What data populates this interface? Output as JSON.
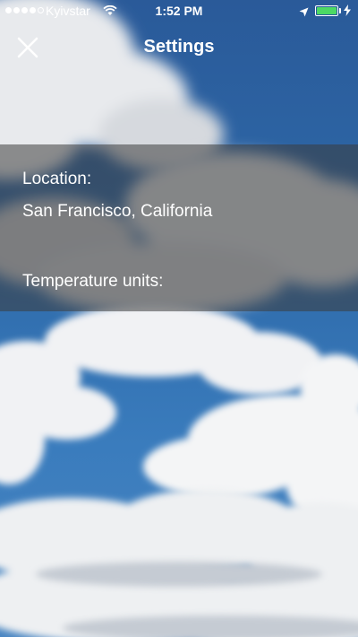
{
  "status_bar": {
    "signal_bars_filled": 4,
    "signal_bars_total": 5,
    "carrier": "Kyivstar",
    "time": "1:52 PM",
    "battery_level": 1.0,
    "battery_color": "#4cd964",
    "icons": [
      "wifi-icon",
      "location-arrow-icon",
      "battery-icon",
      "charging-bolt-icon"
    ]
  },
  "header": {
    "title": "Settings",
    "close_icon": "close-icon"
  },
  "settings": {
    "location_label": "Location:",
    "location_value": "San Francisco, California",
    "temperature_units_label": "Temperature units:"
  },
  "colors": {
    "panel_overlay": "rgba(60,60,60,0.55)",
    "sky_blue": "#2e6aaa"
  }
}
